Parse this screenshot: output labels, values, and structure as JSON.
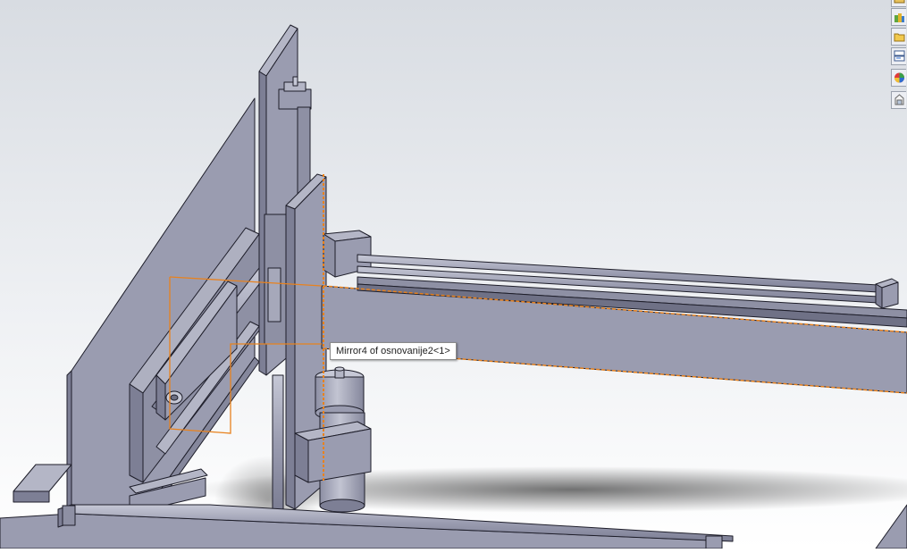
{
  "viewport": {
    "tooltip_text": "Mirror4 of osnovanije2<1>"
  },
  "colors": {
    "model": "#9a9cb0",
    "model_dark": "#7d7f95",
    "model_light": "#b4b6c6",
    "edge": "#1e1e2a",
    "selection_highlight": "#e8821e",
    "background_top": "#d9dde3",
    "background_bottom": "#ffffff"
  },
  "task_pane": {
    "buttons": [
      {
        "name": "solidworks-resources-icon"
      },
      {
        "name": "design-library-icon"
      },
      {
        "name": "file-explorer-icon"
      },
      {
        "name": "view-palette-icon"
      },
      {
        "name": "appearances-icon"
      },
      {
        "name": "custom-properties-icon"
      }
    ]
  }
}
